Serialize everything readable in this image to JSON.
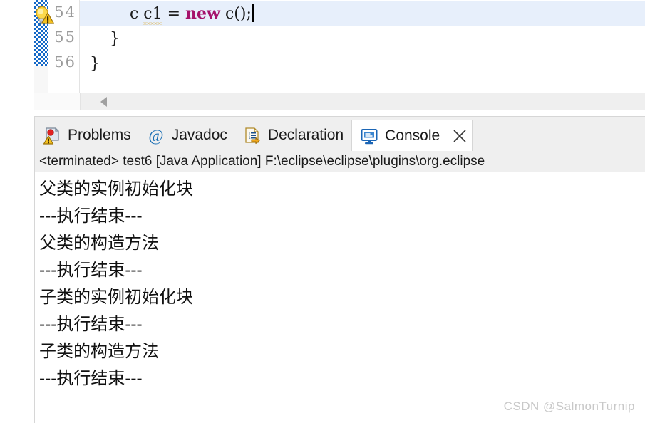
{
  "editor": {
    "gutter_lines": [
      "54",
      "55",
      "56"
    ],
    "quickfix_icon": "lightbulb-warning-icon",
    "highlight_color": "#e7effb",
    "keyword_color": "#a5116b",
    "warning_underline_color": "#d9a21b",
    "lines": [
      {
        "indent": "        ",
        "type_token": "c",
        "var_token": "c1",
        "assign": " = ",
        "keyword": "new",
        "tail": " c();"
      },
      {
        "text": "    }"
      },
      {
        "text": "}"
      }
    ],
    "scrollbar": {
      "left_arrow_icon": "triangle-left-icon"
    }
  },
  "bottom_view": {
    "tabs": [
      {
        "label": "Problems",
        "icon": "problems-icon",
        "active": false
      },
      {
        "label": "Javadoc",
        "icon": "javadoc-at-icon",
        "active": false
      },
      {
        "label": "Declaration",
        "icon": "declaration-icon",
        "active": false
      },
      {
        "label": "Console",
        "icon": "console-monitor-icon",
        "active": true
      }
    ],
    "close_icon": "close-icon",
    "terminated_line": "<terminated> test6 [Java Application] F:\\eclipse\\eclipse\\plugins\\org.eclipse",
    "console_lines": [
      "父类的实例初始化块",
      "---执行结束---",
      "父类的构造方法",
      "---执行结束---",
      "子类的实例初始化块",
      "---执行结束---",
      "子类的构造方法",
      "---执行结束---"
    ]
  },
  "watermark": "CSDN @SalmonTurnip"
}
